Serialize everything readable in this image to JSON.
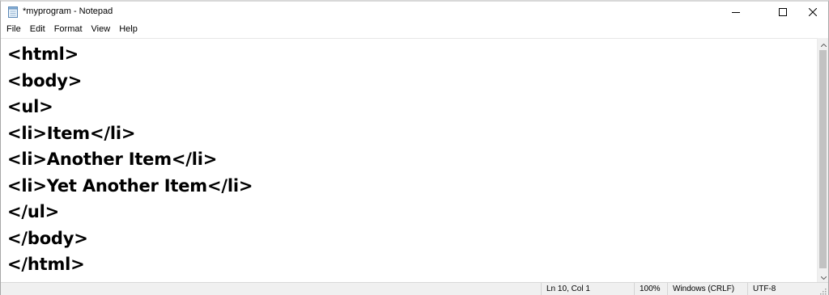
{
  "window": {
    "title": "*myprogram - Notepad",
    "app_icon": "notepad-icon",
    "controls": [
      "minimize-icon",
      "maximize-icon",
      "close-icon"
    ]
  },
  "menu": {
    "items": [
      "File",
      "Edit",
      "Format",
      "View",
      "Help"
    ]
  },
  "editor": {
    "lines": [
      "<html>",
      "<body>",
      "<ul>",
      "<li>Item</li>",
      "<li>Another Item</li>",
      "<li>Yet Another Item</li>",
      "</ul>",
      "</body>",
      "</html>"
    ]
  },
  "status": {
    "position": "Ln 10, Col 1",
    "zoom": "100%",
    "line_ending": "Windows (CRLF)",
    "encoding": "UTF-8"
  },
  "colors": {
    "background": "#ffffff",
    "chrome": "#f0f0f0",
    "text": "#000000",
    "scroll_thumb": "#c2c2c2"
  }
}
